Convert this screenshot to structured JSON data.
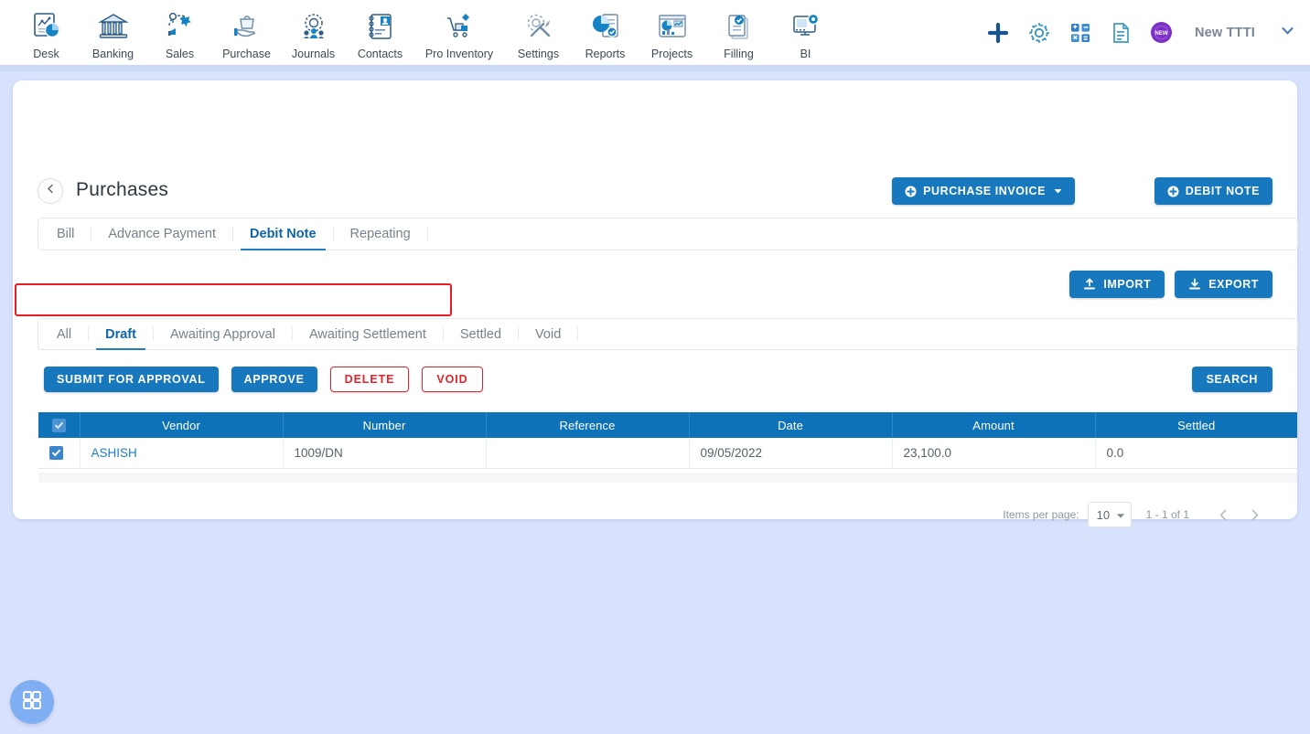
{
  "topnav": {
    "items": [
      {
        "label": "Desk",
        "icon": "dashboard-chart-icon"
      },
      {
        "label": "Banking",
        "icon": "bank-building-icon"
      },
      {
        "label": "Sales",
        "icon": "sales-megaphone-icon"
      },
      {
        "label": "Purchase",
        "icon": "purchase-bag-hand-icon"
      },
      {
        "label": "Journals",
        "icon": "journals-gear-people-icon"
      },
      {
        "label": "Contacts",
        "icon": "contacts-book-icon"
      },
      {
        "label": "Pro Inventory",
        "icon": "inventory-cart-icon"
      },
      {
        "label": "Settings",
        "icon": "settings-gear-wrench-icon"
      },
      {
        "label": "Reports",
        "icon": "reports-piechart-doc-icon"
      },
      {
        "label": "Projects",
        "icon": "projects-dashboard-icon"
      },
      {
        "label": "Filling",
        "icon": "filling-documents-check-icon"
      },
      {
        "label": "BI",
        "icon": "bi-monitor-gear-icon"
      }
    ]
  },
  "header_right": {
    "icons": [
      {
        "name": "add-plus-icon",
        "color": "#17558f"
      },
      {
        "name": "gear-icon",
        "color": "#2f91c4"
      },
      {
        "name": "calculator-icon",
        "color": "#2f7ec9"
      },
      {
        "name": "notes-document-icon",
        "color": "#3f9ac6"
      },
      {
        "name": "new-badge-icon",
        "color": "#7b2fc4",
        "text": "NEW"
      }
    ],
    "user_name": "New TTTI",
    "chevron": "chevron-down-icon"
  },
  "page": {
    "title": "Purchases",
    "back_icon": "chevron-left-icon"
  },
  "header_buttons": {
    "purchase_invoice": "PURCHASE INVOICE",
    "debit_note": "DEBIT NOTE"
  },
  "module_tabs": [
    {
      "label": "Bill",
      "active": false
    },
    {
      "label": "Advance Payment",
      "active": false
    },
    {
      "label": "Debit Note",
      "active": true
    },
    {
      "label": "Repeating",
      "active": false
    }
  ],
  "io_buttons": {
    "import": "IMPORT",
    "export": "EXPORT"
  },
  "status_tabs": [
    {
      "label": "All",
      "active": false
    },
    {
      "label": "Draft",
      "active": true
    },
    {
      "label": "Awaiting Approval",
      "active": false
    },
    {
      "label": "Awaiting Settlement",
      "active": false
    },
    {
      "label": "Settled",
      "active": false
    },
    {
      "label": "Void",
      "active": false
    }
  ],
  "action_buttons": {
    "submit_for_approval": "SUBMIT FOR APPROVAL",
    "approve": "APPROVE",
    "delete": "DELETE",
    "void": "VOID",
    "search": "SEARCH",
    "highlight_color": "#ec1c24"
  },
  "table": {
    "columns": [
      "Vendor",
      "Number",
      "Reference",
      "Date",
      "Amount",
      "Settled"
    ],
    "header_checkbox_checked": true,
    "rows": [
      {
        "checked": true,
        "vendor": "ASHISH",
        "number": "1009/DN",
        "reference": "",
        "date": "09/05/2022",
        "amount": "23,100.0",
        "settled": "0.0"
      }
    ]
  },
  "pagination": {
    "items_per_page_label": "Items per page:",
    "items_per_page_value": "10",
    "range": "1 - 1 of 1",
    "prev_icon": "chevron-left-icon",
    "next_icon": "chevron-right-icon"
  },
  "fab": {
    "icon": "grid-apps-icon"
  },
  "colors": {
    "page_bg": "#d9e2fd",
    "primary_blue": "#1878bd",
    "table_header_blue": "#0d72b7",
    "link_blue": "#1f7ec4",
    "danger_red": "#e0242c"
  }
}
